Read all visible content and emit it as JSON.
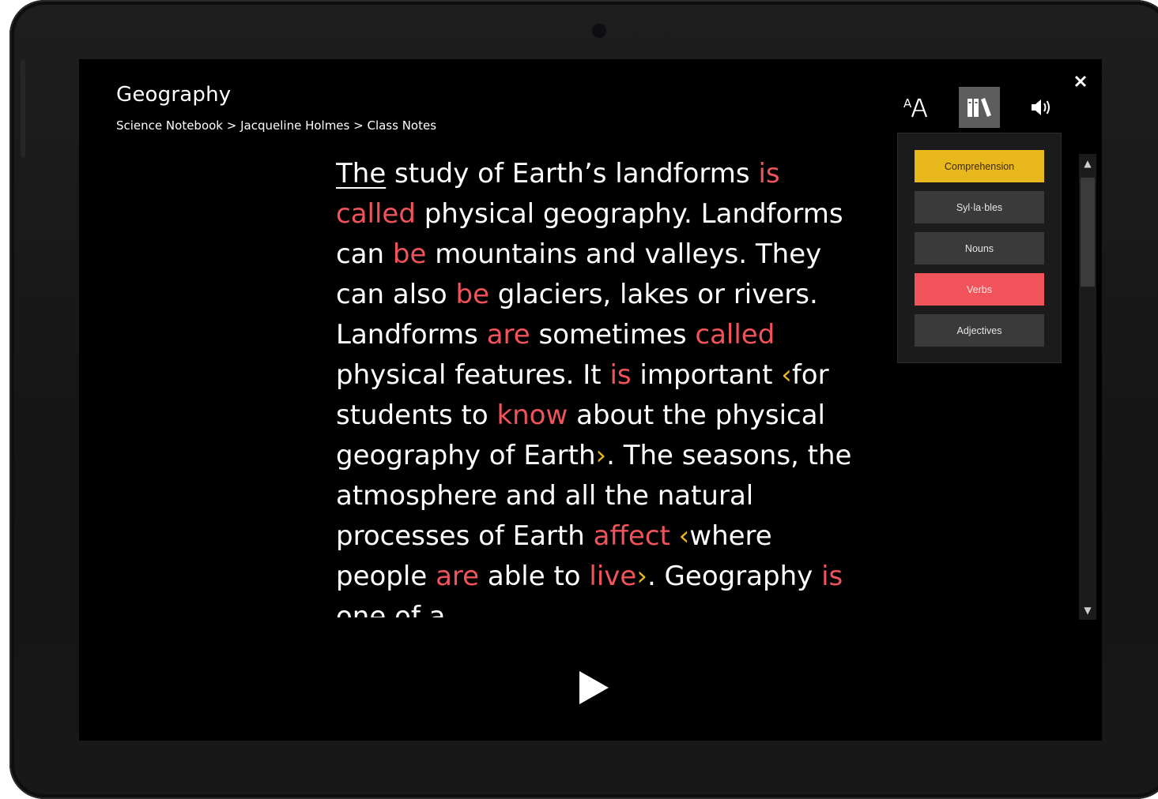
{
  "window": {
    "title": "Geography",
    "breadcrumb": [
      "Science Notebook",
      "Jacqueline Holmes",
      "Class Notes"
    ],
    "breadcrumb_separator": " > "
  },
  "toolbar": {
    "text_options_icon": "text-size-icon",
    "grammar_options_icon": "books-icon",
    "voice_options_icon": "speaker-icon",
    "close_icon": "close-icon",
    "active_button": "grammar-options"
  },
  "grammar_options": [
    {
      "label": "Comprehension",
      "color": "#e8b81c",
      "active": true
    },
    {
      "label": "Syl·la·bles",
      "active": false
    },
    {
      "label": "Nouns",
      "active": false
    },
    {
      "label": "Verbs",
      "color": "#f0545a",
      "active": true
    },
    {
      "label": "Adjectives",
      "active": false
    }
  ],
  "reading": {
    "words": [
      [
        "The",
        "first"
      ],
      [
        " study of Earth’s landforms ",
        ""
      ],
      [
        "is",
        "verb"
      ],
      [
        " ",
        ""
      ],
      [
        "called",
        "verb"
      ],
      [
        " physical geography. Landforms can ",
        ""
      ],
      [
        "be",
        "verb"
      ],
      [
        " mountains and valleys. They can also ",
        ""
      ],
      [
        "be",
        "verb"
      ],
      [
        " glaciers, lakes or rivers. Landforms ",
        ""
      ],
      [
        "are",
        "verb"
      ],
      [
        " sometimes ",
        ""
      ],
      [
        "called",
        "verb"
      ],
      [
        " physical features. It ",
        ""
      ],
      [
        "is",
        "verb"
      ],
      [
        " important ",
        ""
      ],
      [
        "‹",
        "clause"
      ],
      [
        "for students to ",
        ""
      ],
      [
        "know",
        "verb"
      ],
      [
        " about the physical geography of Earth",
        ""
      ],
      [
        "›",
        "clause"
      ],
      [
        ". The seasons, the atmosphere and all the natural processes of Earth ",
        ""
      ],
      [
        "affect",
        "verb"
      ],
      [
        " ",
        ""
      ],
      [
        "‹",
        "clause"
      ],
      [
        "where people ",
        ""
      ],
      [
        "are",
        "verb"
      ],
      [
        " able to ",
        ""
      ],
      [
        "live",
        "verb"
      ],
      [
        "›",
        "clause"
      ],
      [
        ". Geography ",
        ""
      ],
      [
        "is",
        "verb"
      ],
      [
        " one of a",
        ""
      ]
    ]
  },
  "playback": {
    "icon": "play-icon"
  },
  "colors": {
    "verb": "#f0545a",
    "comprehension": "#e8b81c",
    "background": "#000000",
    "panel": "#1b1b1b"
  }
}
